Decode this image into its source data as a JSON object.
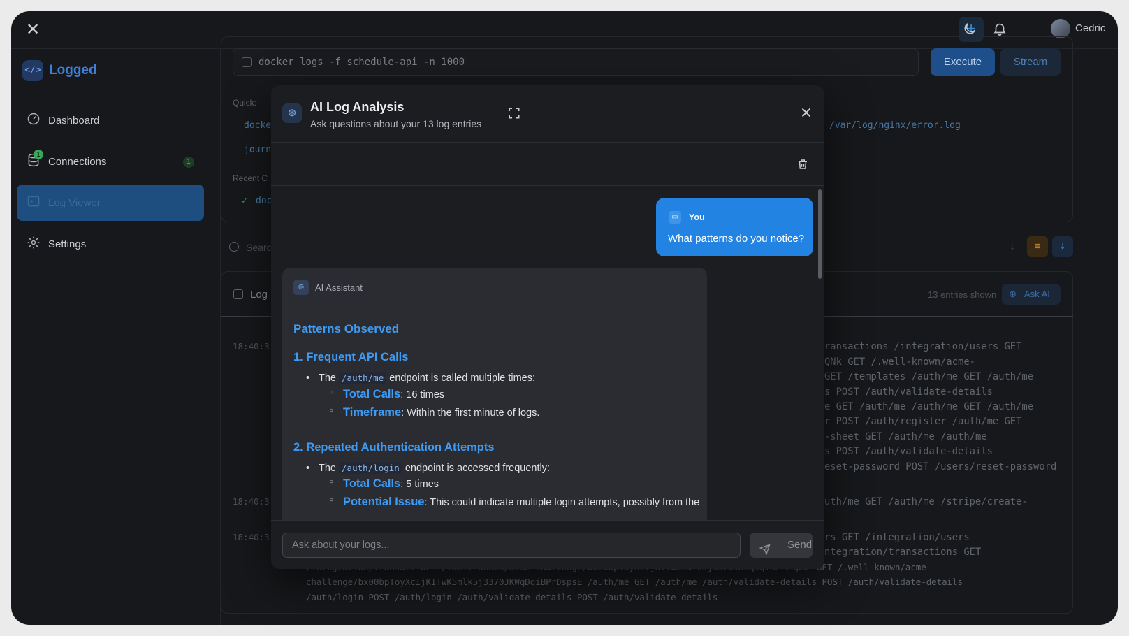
{
  "user": {
    "name": "Cedric"
  },
  "brand": {
    "name": "Logged",
    "icon": "code-icon"
  },
  "sidebar": {
    "items": [
      {
        "label": "Dashboard",
        "icon": "dashboard-icon"
      },
      {
        "label": "Connections",
        "icon": "database-icon",
        "badge": "1",
        "count": "1"
      },
      {
        "label": "Log Viewer",
        "icon": "terminal-icon",
        "active": true
      },
      {
        "label": "Settings",
        "icon": "gear-icon"
      }
    ]
  },
  "command": {
    "value": "docker logs -f schedule-api -n 1000",
    "execute_label": "Execute",
    "stream_label": "Stream",
    "quick_label": "Quick:",
    "quick_items": [
      "docke",
      "journa"
    ],
    "quick_right": "/var/log/nginx/error.log",
    "recent_label": "Recent C",
    "recent_item": "doc"
  },
  "search": {
    "placeholder": "Searc"
  },
  "log_panel": {
    "title": "Log",
    "entries_shown": "13 entries shown",
    "ask_ai_label": "Ask AI",
    "timestamps": [
      "18:40:3",
      "18:40:3",
      "18:40:3"
    ],
    "lines": [
      "ransactions /integration/users GET",
      "QNk GET /.well-known/acme-",
      "GET /templates /auth/me GET /auth/me",
      "s POST /auth/validate-details",
      "e GET /auth/me /auth/me GET /auth/me",
      "r POST /auth/register /auth/me GET",
      "-sheet GET /auth/me /auth/me",
      "s POST /auth/validate-details",
      "eset-password POST /users/reset-password",
      "uth/me GET /auth/me /stripe/create-",
      "rs GET /integration/users",
      "ntegration/transactions GET",
      "/integration/transactions /.well-known/acme-challenge/bx00bpToyXcIjKITwK5mlk5j3370JKWqDqiBPrDspsE GET /.well-known/acme-",
      "challenge/bx00bpToyXcIjKITwK5mlk5j3370JKWqDqiBPrDspsE /auth/me GET /auth/me /auth/validate-details POST /auth/validate-details",
      "/auth/login POST /auth/login /auth/validate-details POST /auth/validate-details"
    ]
  },
  "modal": {
    "title": "AI Log Analysis",
    "subtitle": "Ask questions about your 13 log entries",
    "user_label": "You",
    "user_message": "What patterns do you notice?",
    "ai_label": "AI Assistant",
    "heading": "Patterns Observed",
    "section1": {
      "title": "1. Frequent API Calls",
      "bullet_pre": "The ",
      "bullet_code": "/auth/me",
      "bullet_post": " endpoint is called multiple times:",
      "sub1_key": "Total Calls",
      "sub1_val": ": 16 times",
      "sub2_key": "Timeframe",
      "sub2_val": ": Within the first minute of logs."
    },
    "section2": {
      "title": "2. Repeated Authentication Attempts",
      "bullet_pre": "The ",
      "bullet_code": "/auth/login",
      "bullet_post": " endpoint is accessed frequently:",
      "sub1_key": "Total Calls",
      "sub1_val": ": 5 times",
      "sub2_key": "Potential Issue",
      "sub2_val": ": This could indicate multiple login attempts, possibly from the"
    },
    "input_placeholder": "Ask about your logs...",
    "send_label": "Send"
  }
}
